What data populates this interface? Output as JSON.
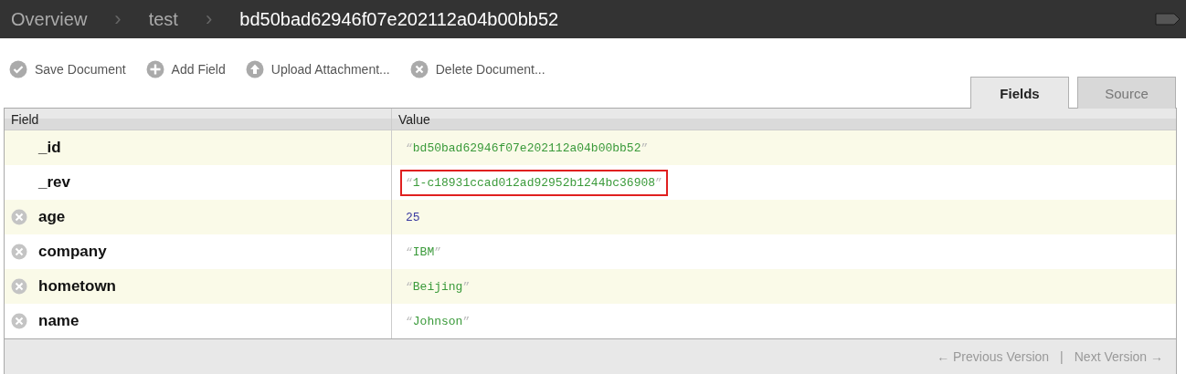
{
  "breadcrumb": [
    {
      "label": "Overview",
      "selected": false
    },
    {
      "label": "test",
      "selected": false
    },
    {
      "label": "bd50bad62946f07e202112a04b00bb52",
      "selected": true
    }
  ],
  "breadcrumb_separator": "›",
  "toolbar": [
    {
      "label": "Save Document",
      "kind": "check"
    },
    {
      "label": "Add Field",
      "kind": "plus"
    },
    {
      "label": "Upload Attachment...",
      "kind": "upload"
    },
    {
      "label": "Delete Document...",
      "kind": "delete"
    }
  ],
  "tabs": [
    {
      "label": "Fields",
      "selected": true
    },
    {
      "label": "Source",
      "selected": false
    }
  ],
  "table": {
    "columns": [
      "Field",
      "Value"
    ],
    "rows": [
      {
        "field": "_id",
        "removable": false,
        "kind": "string",
        "quotes": [
          "“",
          "”"
        ],
        "value": "bd50bad62946f07e202112a04b00bb52",
        "highlighted": false
      },
      {
        "field": "_rev",
        "removable": false,
        "kind": "string",
        "quotes": [
          "“",
          "”"
        ],
        "value": "1-c18931ccad012ad92952b1244bc36908",
        "highlighted": true
      },
      {
        "field": "age",
        "removable": true,
        "kind": "number",
        "value": "25",
        "highlighted": false
      },
      {
        "field": "company",
        "removable": true,
        "kind": "string",
        "quotes": [
          "“",
          "”"
        ],
        "value": "IBM",
        "highlighted": false
      },
      {
        "field": "hometown",
        "removable": true,
        "kind": "string",
        "quotes": [
          "“",
          "”"
        ],
        "value": "Beijing",
        "highlighted": false
      },
      {
        "field": "name",
        "removable": true,
        "kind": "string",
        "quotes": [
          "“",
          "”"
        ],
        "value": "Johnson",
        "highlighted": false
      }
    ]
  },
  "footer": {
    "previous": "← Previous Version",
    "separator": "|",
    "next": "Next Version →"
  }
}
